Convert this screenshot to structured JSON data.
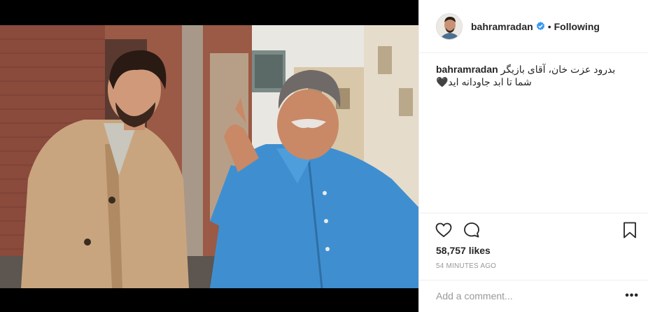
{
  "post": {
    "username": "bahramradan",
    "separator": "•",
    "follow_status": "Following",
    "caption_line1": "بدرود عزت خان، آقای بازیگر",
    "caption_line2": "شما تا ابد جاودانه اید🖤",
    "likes": "58,757 likes",
    "timestamp": "54 MINUTES AGO"
  },
  "comment": {
    "placeholder": "Add a comment...",
    "more_label": "•••"
  },
  "icons": {
    "verified": "verified-badge-icon",
    "like": "heart-icon",
    "comment": "comment-bubble-icon",
    "save": "bookmark-icon"
  },
  "colors": {
    "verified_blue": "#3897f0",
    "text": "#262626",
    "muted": "#999999",
    "border": "#efefef",
    "media_bg": "#000000"
  }
}
